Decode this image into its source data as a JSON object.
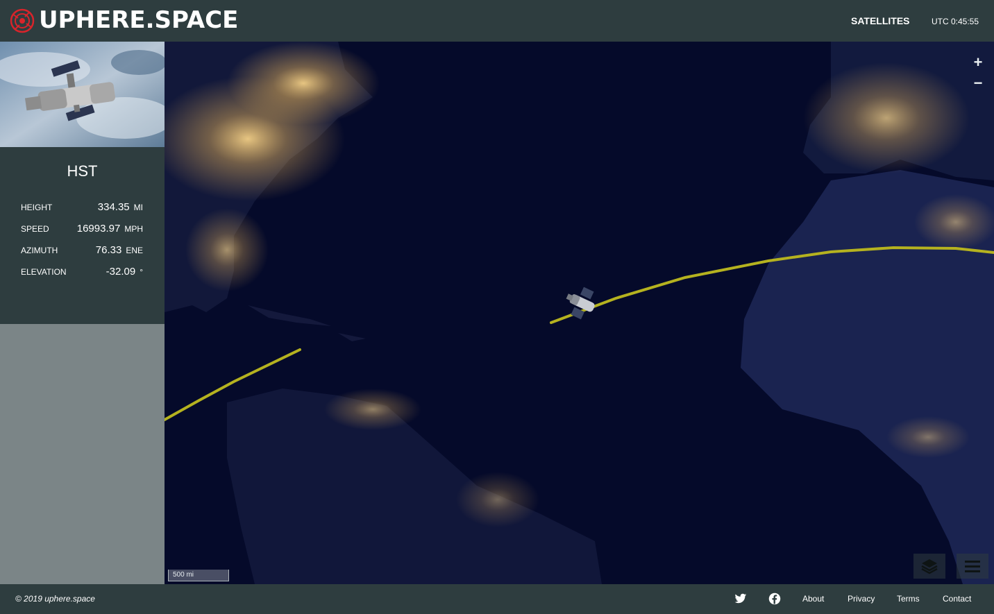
{
  "brand": {
    "name": "UPHERE.SPACE"
  },
  "nav": {
    "satellites_label": "SATELLITES",
    "utc_time": "UTC 0:45:55"
  },
  "satellite": {
    "name": "HST",
    "stats": [
      {
        "label": "HEIGHT",
        "value": "334.35",
        "unit": "MI"
      },
      {
        "label": "SPEED",
        "value": "16993.97",
        "unit": "MPH"
      },
      {
        "label": "AZIMUTH",
        "value": "76.33",
        "unit": "ENE"
      },
      {
        "label": "ELEVATION",
        "value": "-32.09",
        "unit": "°"
      }
    ]
  },
  "map": {
    "zoom_in_label": "+",
    "zoom_out_label": "−",
    "scale_label": "500 mi",
    "orbit_color": "#b5b21f"
  },
  "footer": {
    "copyright": "© 2019 uphere.space",
    "links": [
      "About",
      "Privacy",
      "Terms",
      "Contact"
    ]
  },
  "colors": {
    "panel": "#2e3d3f",
    "sidebar_empty": "#7b8587",
    "map_ocean": "#050a2a"
  }
}
